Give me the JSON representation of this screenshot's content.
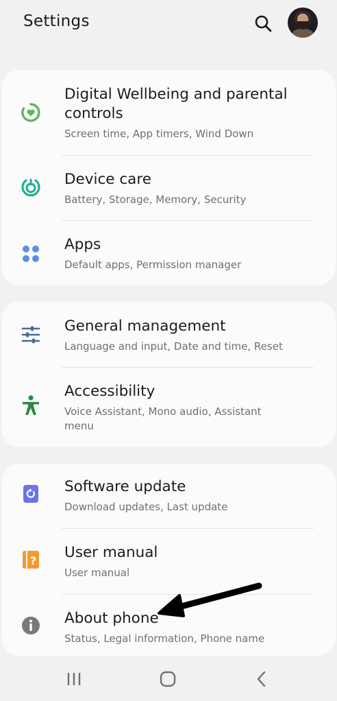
{
  "header": {
    "title": "Settings"
  },
  "groups": [
    {
      "items": [
        {
          "title": "Digital Wellbeing and parental controls",
          "subtitle": "Screen time, App timers, Wind Down",
          "icon": "digital-wellbeing-icon",
          "color": "#5cb85c"
        },
        {
          "title": "Device care",
          "subtitle": "Battery, Storage, Memory, Security",
          "icon": "device-care-icon",
          "color": "#1fae95"
        },
        {
          "title": "Apps",
          "subtitle": "Default apps, Permission manager",
          "icon": "apps-icon",
          "color": "#5b8fe0"
        }
      ]
    },
    {
      "items": [
        {
          "title": "General management",
          "subtitle": "Language and input, Date and time, Reset",
          "icon": "sliders-icon",
          "color": "#4a6a90"
        },
        {
          "title": "Accessibility",
          "subtitle": "Voice Assistant, Mono audio, Assistant menu",
          "icon": "accessibility-icon",
          "color": "#2e8a43"
        }
      ]
    },
    {
      "items": [
        {
          "title": "Software update",
          "subtitle": "Download updates, Last update",
          "icon": "software-update-icon",
          "color": "#6b73e8"
        },
        {
          "title": "User manual",
          "subtitle": "User manual",
          "icon": "user-manual-icon",
          "color": "#f29b30"
        },
        {
          "title": "About phone",
          "subtitle": "Status, Legal information, Phone name",
          "icon": "info-icon",
          "color": "#7a7a7a"
        }
      ]
    }
  ],
  "navbar": {
    "recents": "recents-icon",
    "home": "home-icon",
    "back": "back-icon"
  }
}
